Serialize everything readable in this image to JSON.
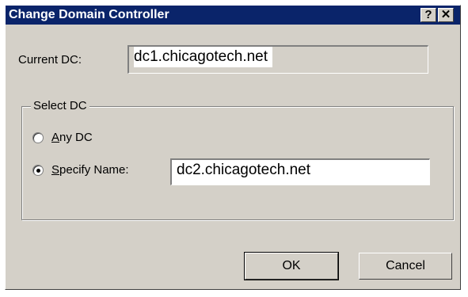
{
  "window": {
    "title": "Change Domain Controller",
    "help_button": "?",
    "close_button": "✕"
  },
  "current_dc": {
    "label": "Current DC:",
    "value": "dc1.chicagotech.net"
  },
  "select_dc": {
    "group_label": "Select DC",
    "any_dc": {
      "label_first": "A",
      "label_rest": "ny DC",
      "selected": false
    },
    "specify_name": {
      "label_first": "S",
      "label_rest": "pecify Name:",
      "selected": true,
      "value": "dc2.chicagotech.net"
    }
  },
  "buttons": {
    "ok": "OK",
    "cancel": "Cancel"
  }
}
